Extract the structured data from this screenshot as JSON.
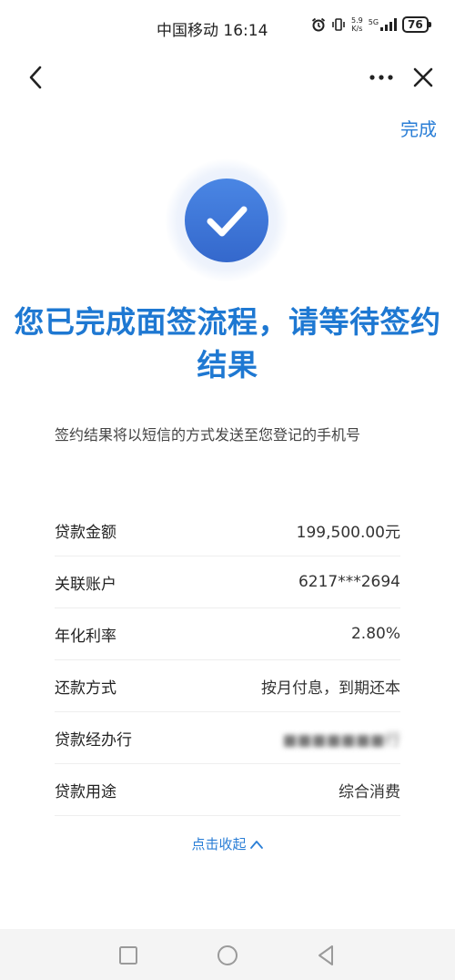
{
  "status_bar": {
    "carrier_time": "中国移动 16:14",
    "speed_value": "5.9",
    "speed_unit": "K/s",
    "network": "5G",
    "battery": "76",
    "icons": [
      "alarm-icon",
      "vibrate-icon",
      "signal-icon",
      "battery-icon"
    ]
  },
  "nav": {
    "back_icon": "back-chevron-icon",
    "more_icon": "more-dots-icon",
    "close_icon": "close-icon"
  },
  "done_label": "完成",
  "success_icon": "checkmark-circle-icon",
  "headline": {
    "line1": "您已完成面签流程，请等待签约",
    "line2": "结果"
  },
  "notice_text": "签约结果将以短信的方式发送至您登记的手机号",
  "loan_details": [
    {
      "label": "贷款金额",
      "value": "199,500.00元"
    },
    {
      "label": "关联账户",
      "value": "6217***2694"
    },
    {
      "label": "年化利率",
      "value": "2.80%"
    },
    {
      "label": "还款方式",
      "value": "按月付息，到期还本"
    },
    {
      "label": "贷款经办行",
      "value": "■■■■■■■行"
    },
    {
      "label": "贷款用途",
      "value": "综合消费"
    }
  ],
  "collapse_label": "点击收起",
  "colors": {
    "accent": "#1e78d2",
    "link": "#2a7ed6",
    "check_circle": "#3f78d8",
    "check_halo": "#eaf1fb"
  },
  "system_nav": [
    "square-icon",
    "circle-icon",
    "triangle-back-icon"
  ]
}
